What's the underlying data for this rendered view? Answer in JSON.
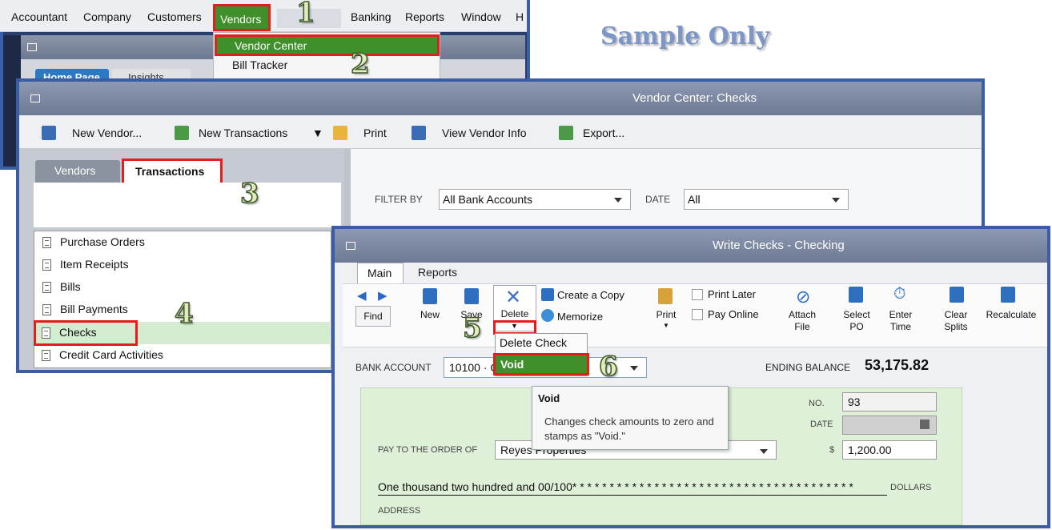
{
  "menubar": {
    "items": [
      "Accountant",
      "Company",
      "Customers",
      "Vendors",
      "Banking",
      "Reports",
      "Window",
      "H"
    ]
  },
  "vendors_menu": {
    "items": [
      "Vendor Center",
      "Bill Tracker"
    ]
  },
  "home_tabs": [
    "Home Page",
    "Insights"
  ],
  "watermark": "Sample Only",
  "steps": [
    "1",
    "2",
    "3",
    "4",
    "5",
    "6"
  ],
  "vendor_center": {
    "title": "Vendor Center: Checks",
    "toolbar": [
      "New Vendor...",
      "New Transactions",
      "Print",
      "View Vendor Info",
      "Export..."
    ],
    "tabs": [
      "Vendors",
      "Transactions"
    ],
    "transactions": [
      "Purchase Orders",
      "Item Receipts",
      "Bills",
      "Bill Payments",
      "Checks",
      "Credit Card Activities"
    ],
    "filter_label": "FILTER BY",
    "filter_value": "All Bank Accounts",
    "date_label": "DATE",
    "date_value": "All"
  },
  "write_checks": {
    "title": "Write Checks - Checking",
    "tabs": [
      "Main",
      "Reports"
    ],
    "ribbon": {
      "find": "Find",
      "new": "New",
      "save": "Save",
      "delete": "Delete",
      "create_copy": "Create a Copy",
      "memorize": "Memorize",
      "print": "Print",
      "print_later": "Print Later",
      "pay_online": "Pay Online",
      "attach_file": "Attach File",
      "select_po": "Select PO",
      "enter_time": "Enter Time",
      "clear_splits": "Clear Splits",
      "recalculate": "Recalculate"
    },
    "delete_menu": [
      "Delete Check",
      "Void"
    ],
    "tooltip_title": "Void",
    "tooltip_body": "Changes check amounts to zero and stamps as \"Void.\"",
    "bank_account_label": "BANK ACCOUNT",
    "bank_account_value": "10100 · C",
    "ending_balance_label": "ENDING BALANCE",
    "ending_balance": "53,175.82",
    "no_label": "NO.",
    "check_no": "93",
    "date_label": "DATE",
    "pay_to_label": "PAY TO THE ORDER OF",
    "payee": "Reyes Properties",
    "dollar_sign": "$",
    "amount": "1,200.00",
    "amount_words": "One thousand two hundred and 00/100* * * * * * * * * * * * * * * * * * * * * * * * * * * * * * * * * * * * * *",
    "dollars_label": "DOLLARS",
    "address_label": "ADDRESS"
  }
}
